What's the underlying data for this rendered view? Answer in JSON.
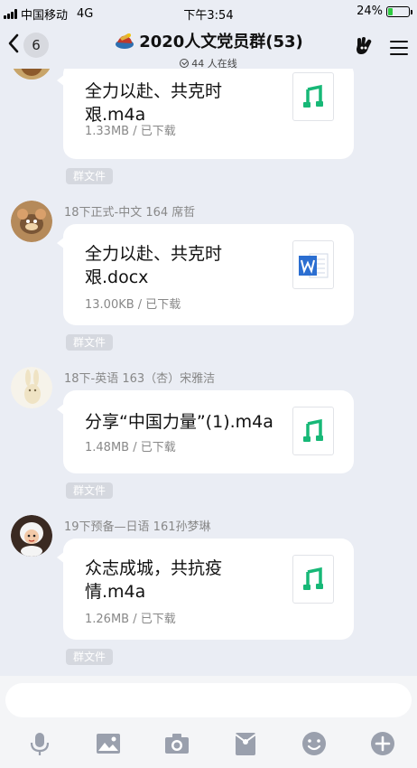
{
  "status_bar": {
    "carrier": "中国移动",
    "network": "4G",
    "time": "下午3:54",
    "battery": "24%",
    "battery_level": 0.24,
    "battery_color": "#2ecc40"
  },
  "nav": {
    "back_count": "6",
    "title": "2020人文党员群(53)",
    "online": "44 人在线"
  },
  "messages": [
    {
      "sender": "",
      "file_name": "全力以赴、共克时艰.m4a",
      "file_meta": "1.33MB / 已下载",
      "file_type": "audio",
      "tag": "群文件"
    },
    {
      "sender": "18下正式-中文 164 席哲",
      "file_name": "全力以赴、共克时艰.docx",
      "file_meta": "13.00KB / 已下载",
      "file_type": "word",
      "tag": "群文件"
    },
    {
      "sender": "18下-英语 163（杏）宋雅洁",
      "file_name": "分享“中国力量”(1).m4a",
      "file_meta": "1.48MB / 已下载",
      "file_type": "audio",
      "tag": "群文件"
    },
    {
      "sender": "19下预备—日语 161孙梦琳",
      "file_name": "众志成城，共抗疫情.m4a",
      "file_meta": "1.26MB / 已下载",
      "file_type": "audio",
      "tag": "群文件"
    }
  ],
  "colors": {
    "audio_icon": "#17b877",
    "word_icon": "#2b6ed1",
    "toolbar_icon": "#9aa0ad"
  },
  "icons": {
    "audio": "music-note-icon",
    "word": "word-document-icon",
    "toolbar": [
      "microphone-icon",
      "image-icon",
      "camera-icon",
      "red-packet-icon",
      "emoji-icon",
      "plus-icon"
    ]
  }
}
